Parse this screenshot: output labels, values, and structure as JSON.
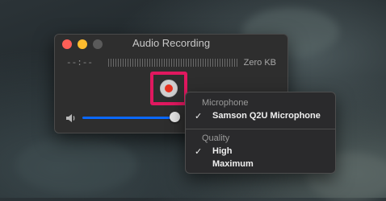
{
  "window": {
    "title": "Audio Recording"
  },
  "recorder": {
    "timer": "--:--",
    "size": "Zero KB",
    "volume_level": 0.93
  },
  "menu": {
    "microphone_header": "Microphone",
    "microphone_item": "Samson Q2U Microphone",
    "quality_header": "Quality",
    "quality_high": "High",
    "quality_maximum": "Maximum",
    "check_glyph": "✓"
  },
  "colors": {
    "record_highlight": "#e0185f",
    "record_dot": "#e8321f",
    "slider_blue": "#0a68ff"
  }
}
